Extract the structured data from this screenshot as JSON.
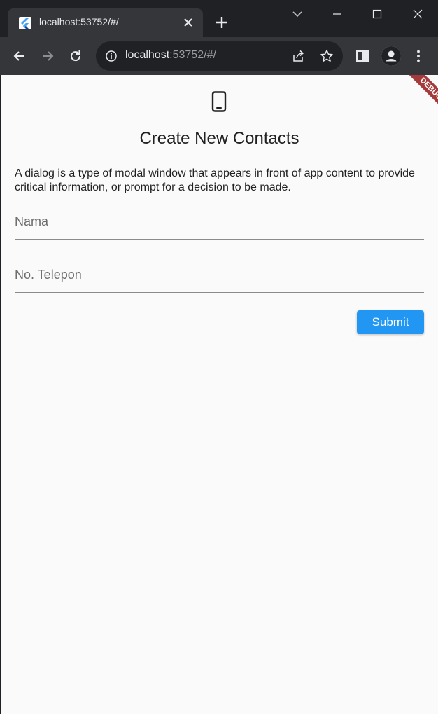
{
  "browser": {
    "tab": {
      "title": "localhost:53752/#/"
    },
    "omnibox": {
      "host": "localhost",
      "rest": ":53752/#/"
    }
  },
  "app": {
    "title": "Create New Contacts",
    "description": "A dialog is a type of modal window that appears in front of app content to provide critical information, or prompt for a decision to be made.",
    "fields": [
      {
        "placeholder": "Nama",
        "value": ""
      },
      {
        "placeholder": "No. Telepon",
        "value": ""
      }
    ],
    "submit_label": "Submit",
    "debug_label": "DEBUG"
  },
  "colors": {
    "accent": "#2196f3",
    "debug_banner": "#a53a3a",
    "page_background": "#fafafa",
    "chrome_frame": "#202124",
    "chrome_toolbar": "#35363a"
  },
  "icons": {
    "favicon": "flutter-logo",
    "header": "smartphone-icon"
  }
}
